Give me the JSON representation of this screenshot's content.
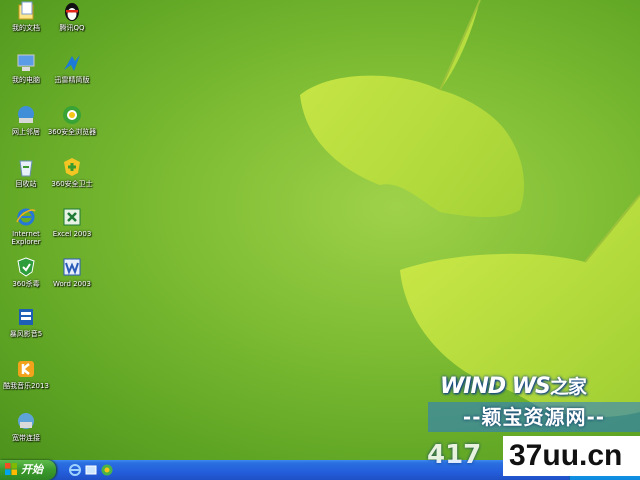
{
  "desktop_icons": [
    {
      "label": "我的文档",
      "icon": "my-documents-icon"
    },
    {
      "label": "腾讯QQ",
      "icon": "qq-penguin-icon"
    },
    {
      "label": "我的电脑",
      "icon": "my-computer-icon"
    },
    {
      "label": "迅雷精简版",
      "icon": "thunder-icon"
    },
    {
      "label": "网上邻居",
      "icon": "network-icon"
    },
    {
      "label": "360安全浏览器",
      "icon": "360-browser-icon"
    },
    {
      "label": "回收站",
      "icon": "recycle-bin-icon"
    },
    {
      "label": "360安全卫士",
      "icon": "360-security-icon"
    },
    {
      "label": "Internet Explorer",
      "icon": "internet-explorer-icon"
    },
    {
      "label": "Excel 2003",
      "icon": "excel-icon"
    },
    {
      "label": "360杀毒",
      "icon": "360-antivirus-icon"
    },
    {
      "label": "Word 2003",
      "icon": "word-icon"
    },
    {
      "label": "暴风影音5",
      "icon": "baofeng-player-icon"
    },
    {
      "label": "酷我音乐2013",
      "icon": "kuwo-music-icon"
    },
    {
      "label": "宽带连接",
      "icon": "broadband-icon"
    }
  ],
  "taskbar": {
    "start_label": "开始",
    "quick_launch": [
      "internet-explorer-icon",
      "show-desktop-icon",
      "360-browser-icon"
    ]
  },
  "watermarks": {
    "brand": "WIND WS",
    "brand_suffix": "之家",
    "site_name": "--颖宝资源网--",
    "site_num": "417",
    "site_url": "37uu.cn"
  }
}
